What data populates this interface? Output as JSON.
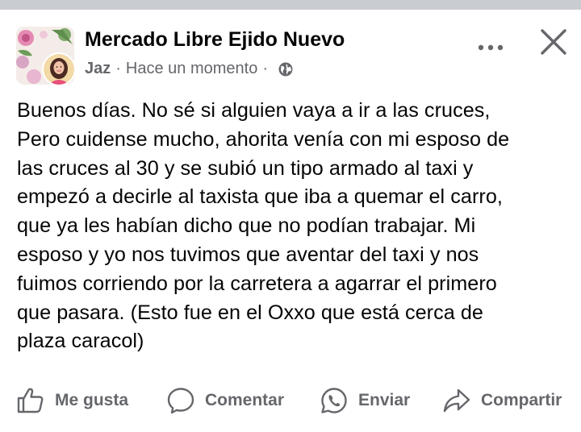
{
  "post": {
    "group_name": "Mercado Libre Ejido Nuevo",
    "author": "Jaz",
    "time": "Hace un momento",
    "separator": "·",
    "lines": [
      "Buenos días. No sé si alguien vaya a ir a las cruces,",
      "Pero cuidense mucho, ahorita venía con mi esposo de",
      "las cruces al 30 y se subió un tipo armado al taxi y",
      "empezó a decirle al taxista que iba a quemar el carro,",
      "que ya les habían dicho que no podían trabajar. Mi",
      "esposo y yo nos tuvimos que aventar del taxi y nos",
      "fuimos corriendo por la carretera a agarrar el primero",
      "que pasara. (Esto fue en el Oxxo que está cerca de",
      "plaza caracol)"
    ]
  },
  "header_icons": {
    "more": "more-horizontal-icon",
    "close": "close-icon",
    "audience": "globe-icon"
  },
  "actions": {
    "like": {
      "label": "Me gusta",
      "icon": "thumbs-up-icon"
    },
    "comment": {
      "label": "Comentar",
      "icon": "comment-icon"
    },
    "send": {
      "label": "Enviar",
      "icon": "whatsapp-icon"
    },
    "share": {
      "label": "Compartir",
      "icon": "share-icon"
    }
  },
  "colors": {
    "text": "#050505",
    "secondary": "#65676b",
    "divider": "#c9ccd1",
    "background": "#ffffff"
  }
}
